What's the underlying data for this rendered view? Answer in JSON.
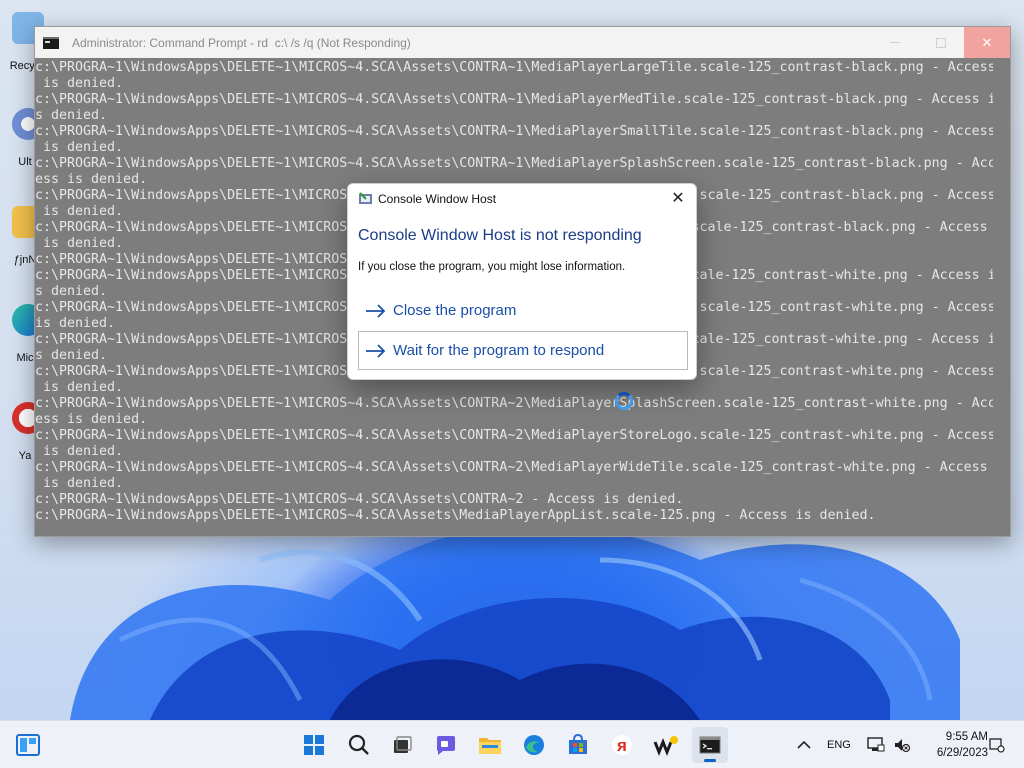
{
  "desktop": {
    "icons": [
      {
        "label": "Recyc",
        "color": "#5fa3e6"
      },
      {
        "label": "Ult",
        "color": "#6f8fd6"
      },
      {
        "label": "ƒjnN",
        "color": "#e0a010"
      },
      {
        "label": "Mic",
        "color": "#2b8be6"
      },
      {
        "label": "Ya",
        "color": "#d9302c"
      }
    ]
  },
  "cmd": {
    "title": "Administrator: Command Prompt - rd  c:\\ /s /q (Not Responding)",
    "lines": [
      "c:\\PROGRA~1\\WindowsApps\\DELETE~1\\MICROS~4.SCA\\Assets\\CONTRA~1\\MediaPlayerLargeTile.scale-125_contrast-black.png - Access",
      " is denied.",
      "c:\\PROGRA~1\\WindowsApps\\DELETE~1\\MICROS~4.SCA\\Assets\\CONTRA~1\\MediaPlayerMedTile.scale-125_contrast-black.png - Access i",
      "s denied.",
      "c:\\PROGRA~1\\WindowsApps\\DELETE~1\\MICROS~4.SCA\\Assets\\CONTRA~1\\MediaPlayerSmallTile.scale-125_contrast-black.png - Access",
      " is denied.",
      "c:\\PROGRA~1\\WindowsApps\\DELETE~1\\MICROS~4.SCA\\Assets\\CONTRA~1\\MediaPlayerSplashScreen.scale-125_contrast-black.png - Acc",
      "ess is denied.",
      "c:\\PROGRA~1\\WindowsApps\\DELETE~1\\MICROS~4.SCA\\Assets\\CONTRA~1\\MediaPlayerStoreLogo.scale-125_contrast-black.png - Access",
      " is denied.",
      "c:\\PROGRA~1\\WindowsApps\\DELETE~1\\MICROS~4.SCA\\Assets\\CONTRA~1\\MediaPlayerWideTile.scale-125_contrast-black.png - Access",
      " is denied.",
      "c:\\PROGRA~1\\WindowsApps\\DELETE~1\\MICROS~4.SCA\\Assets\\CONTRA~2",
      "c:\\PROGRA~1\\WindowsApps\\DELETE~1\\MICROS~4.SCA\\Assets\\CONTRA~2\\MediaPlayerAppList.scale-125_contrast-white.png - Access i",
      "s denied.",
      "c:\\PROGRA~1\\WindowsApps\\DELETE~1\\MICROS~4.SCA\\Assets\\CONTRA~2\\MediaPlayerLargeTile.scale-125_contrast-white.png - Access",
      "is denied.",
      "c:\\PROGRA~1\\WindowsApps\\DELETE~1\\MICROS~4.SCA\\Assets\\CONTRA~2\\MediaPlayerMedTile.scale-125_contrast-white.png - Access i",
      "s denied.",
      "c:\\PROGRA~1\\WindowsApps\\DELETE~1\\MICROS~4.SCA\\Assets\\CONTRA~2\\MediaPlayerSmallTile.scale-125_contrast-white.png - Access",
      " is denied.",
      "c:\\PROGRA~1\\WindowsApps\\DELETE~1\\MICROS~4.SCA\\Assets\\CONTRA~2\\MediaPlayerSplashScreen.scale-125_contrast-white.png - Acc",
      "ess is denied.",
      "c:\\PROGRA~1\\WindowsApps\\DELETE~1\\MICROS~4.SCA\\Assets\\CONTRA~2\\MediaPlayerStoreLogo.scale-125_contrast-white.png - Access",
      " is denied.",
      "c:\\PROGRA~1\\WindowsApps\\DELETE~1\\MICROS~4.SCA\\Assets\\CONTRA~2\\MediaPlayerWideTile.scale-125_contrast-white.png - Access",
      " is denied.",
      "c:\\PROGRA~1\\WindowsApps\\DELETE~1\\MICROS~4.SCA\\Assets\\CONTRA~2 - Access is denied.",
      "c:\\PROGRA~1\\WindowsApps\\DELETE~1\\MICROS~4.SCA\\Assets\\MediaPlayerAppList.scale-125.png - Access is denied."
    ]
  },
  "dialog": {
    "title": "Console Window Host",
    "close_glyph": "✕",
    "heading": "Console Window Host is not responding",
    "info": "If you close the program, you might lose information.",
    "options": [
      {
        "label": "Close the program"
      },
      {
        "label": "Wait for the program to respond"
      }
    ],
    "accent_color": "#1a4fa8"
  },
  "taskbar": {
    "apps": [
      {
        "name": "start-icon"
      },
      {
        "name": "search-icon"
      },
      {
        "name": "task-view-icon"
      },
      {
        "name": "chat-icon"
      },
      {
        "name": "file-explorer-icon"
      },
      {
        "name": "edge-icon"
      },
      {
        "name": "store-icon"
      },
      {
        "name": "yandex-browser-icon"
      },
      {
        "name": "winrar-icon"
      },
      {
        "name": "command-prompt-icon"
      }
    ],
    "language": "ENG",
    "time": "9:55 AM",
    "date": "6/29/2023"
  }
}
